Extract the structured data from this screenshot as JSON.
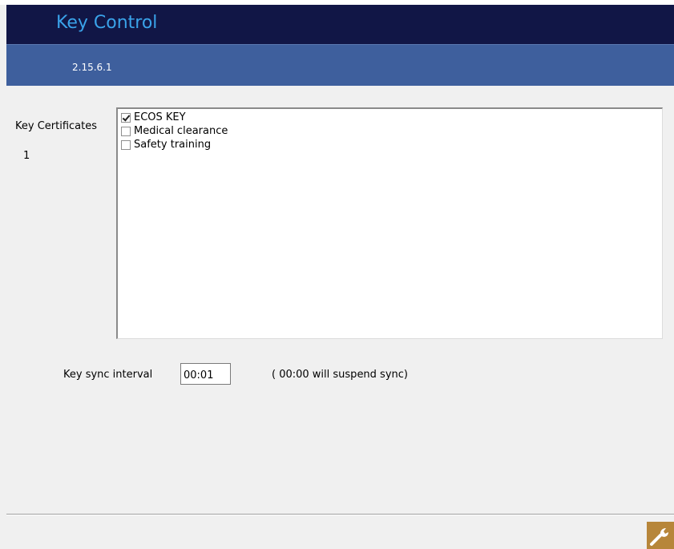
{
  "app": {
    "title": "Key Control",
    "version": "2.15.6.1"
  },
  "certificates": {
    "label": "Key Certificates",
    "count": "1",
    "items": [
      {
        "label": "ECOS KEY",
        "checked": true
      },
      {
        "label": "Medical clearance",
        "checked": false
      },
      {
        "label": "Safety training",
        "checked": false
      }
    ]
  },
  "sync": {
    "label": "Key sync interval",
    "value": "00:01",
    "note": "( 00:00 will suspend sync)"
  },
  "footer": {
    "settings_icon": "wrench-icon"
  },
  "colors": {
    "title_bar": "#111646",
    "title_text": "#3aa3ea",
    "version_bar": "#3e5f9d",
    "settings_button": "#b7863a"
  }
}
